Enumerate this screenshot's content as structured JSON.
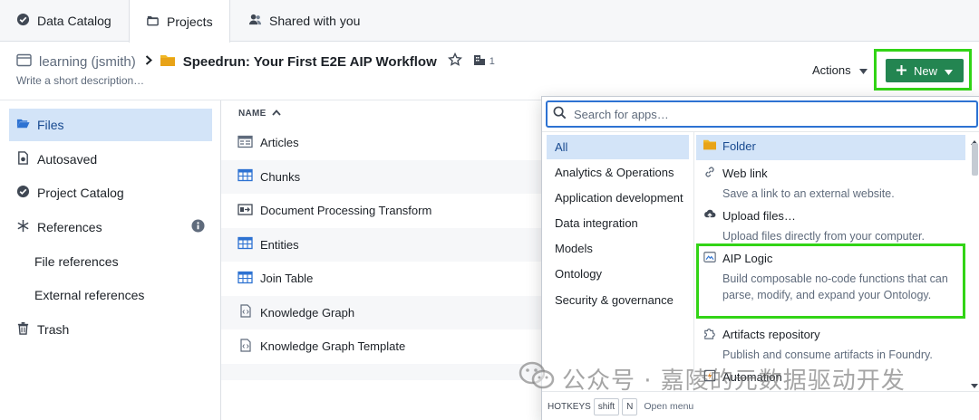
{
  "tabs": [
    {
      "label": "Data Catalog",
      "icon": "check-circle-icon"
    },
    {
      "label": "Projects",
      "icon": "folder-icon"
    },
    {
      "label": "Shared with you",
      "icon": "people-icon"
    }
  ],
  "header": {
    "parent": "learning (jsmith)",
    "title": "Speedrun: Your First E2E AIP Workflow",
    "star_icon": "star-outline-icon",
    "member_count": "1",
    "description_placeholder": "Write a short description…",
    "actions_label": "Actions",
    "new_label": "New"
  },
  "sidebar": {
    "items": [
      {
        "label": "Files",
        "icon": "folder-open-icon"
      },
      {
        "label": "Autosaved",
        "icon": "document-icon"
      },
      {
        "label": "Project Catalog",
        "icon": "check-circle-icon"
      },
      {
        "label": "References",
        "icon": "asterisk-icon"
      },
      {
        "label": "File references"
      },
      {
        "label": "External references"
      },
      {
        "label": "Trash",
        "icon": "trash-icon"
      }
    ]
  },
  "file_list": {
    "column_name": "NAME",
    "rows": [
      {
        "name": "Articles",
        "icon": "dataset-view-icon"
      },
      {
        "name": "Chunks",
        "icon": "table-icon"
      },
      {
        "name": "Document Processing Transform",
        "icon": "transform-icon"
      },
      {
        "name": "Entities",
        "icon": "table-icon"
      },
      {
        "name": "Join Table",
        "icon": "table-icon"
      },
      {
        "name": "Knowledge Graph",
        "icon": "code-file-icon"
      },
      {
        "name": "Knowledge Graph Template",
        "icon": "code-file-icon"
      }
    ]
  },
  "dropdown": {
    "search_placeholder": "Search for apps…",
    "categories": [
      "All",
      "Analytics & Operations",
      "Application development",
      "Data integration",
      "Models",
      "Ontology",
      "Security & governance"
    ],
    "apps": [
      {
        "title": "Folder",
        "desc": "",
        "icon": "folder-icon"
      },
      {
        "title": "Web link",
        "desc": "Save a link to an external website.",
        "icon": "link-icon"
      },
      {
        "title": "Upload files…",
        "desc": "Upload files directly from your computer.",
        "icon": "cloud-upload-icon"
      },
      {
        "title": "AIP Logic",
        "desc": "Build composable no-code functions that can parse, modify, and expand your Ontology.",
        "icon": "aip-logic-icon"
      },
      {
        "title": "Artifacts repository",
        "desc": "Publish and consume artifacts in Foundry.",
        "icon": "puzzle-icon"
      },
      {
        "title": "Automation",
        "desc": "",
        "icon": "automation-icon"
      }
    ],
    "footer": {
      "label": "HOTKEYS",
      "keys": [
        "shift",
        "N"
      ],
      "action": "Open menu"
    }
  },
  "watermark": "公众号 · 嘉陵的元数据驱动开发",
  "colors": {
    "primary": "#238551",
    "highlight": "#32d416",
    "selected_bg": "#d3e4f8",
    "selected_text": "#184a90"
  }
}
